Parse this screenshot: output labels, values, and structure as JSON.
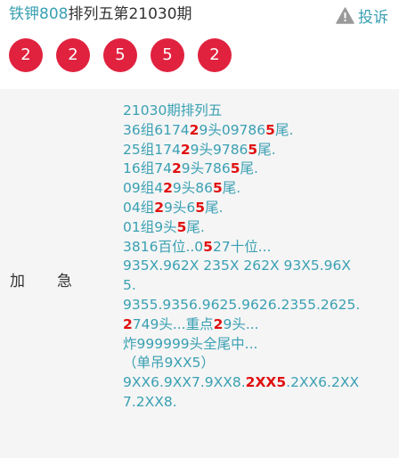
{
  "header": {
    "author": "铁钾808",
    "title_rest": "排列五第21030期",
    "report_label": "投诉",
    "report_icon": "warning-icon"
  },
  "balls": [
    "2",
    "2",
    "5",
    "5",
    "2"
  ],
  "side": {
    "label_1": "加",
    "label_2": "急"
  },
  "content": {
    "lines": [
      [
        {
          "t": "21030期排列五"
        }
      ],
      [
        {
          "t": "36组6174"
        },
        {
          "t": "2",
          "red": true
        },
        {
          "t": "9头09786"
        },
        {
          "t": "5",
          "red": true
        },
        {
          "t": "尾."
        }
      ],
      [
        {
          "t": "25组174"
        },
        {
          "t": "2",
          "red": true
        },
        {
          "t": "9头9786"
        },
        {
          "t": "5",
          "red": true
        },
        {
          "t": "尾."
        }
      ],
      [
        {
          "t": "16组74"
        },
        {
          "t": "2",
          "red": true
        },
        {
          "t": "9头786"
        },
        {
          "t": "5",
          "red": true
        },
        {
          "t": "尾."
        }
      ],
      [
        {
          "t": "09组4"
        },
        {
          "t": "2",
          "red": true
        },
        {
          "t": "9头86"
        },
        {
          "t": "5",
          "red": true
        },
        {
          "t": "尾."
        }
      ],
      [
        {
          "t": "04组"
        },
        {
          "t": "2",
          "red": true
        },
        {
          "t": "9头6"
        },
        {
          "t": "5",
          "red": true
        },
        {
          "t": "尾."
        }
      ],
      [
        {
          "t": "01组9头"
        },
        {
          "t": "5",
          "red": true
        },
        {
          "t": "尾."
        }
      ],
      [
        {
          "t": "3816百位..0"
        },
        {
          "t": "5",
          "red": true
        },
        {
          "t": "27十位..."
        }
      ],
      [
        {
          "t": "935X.962X 235X 262X 93X5.96X"
        }
      ],
      [
        {
          "t": "5."
        }
      ],
      [
        {
          "t": "9355.9356.9625.9626.2355.2625."
        }
      ],
      [
        {
          "t": "2",
          "red": true
        },
        {
          "t": "749头...重点"
        },
        {
          "t": "2",
          "red": true
        },
        {
          "t": "9头..."
        }
      ],
      [
        {
          "t": "炸999999头全尾中..."
        }
      ],
      [
        {
          "t": "（单吊9XX5）"
        }
      ],
      [
        {
          "t": "9XX6.9XX7.9XX8."
        },
        {
          "t": "2XX5",
          "red": true
        },
        {
          "t": ".2XX6.2XX"
        }
      ],
      [
        {
          "t": "7.2XX8."
        }
      ]
    ]
  },
  "colors": {
    "accent": "#3aa0b3",
    "ball": "#e0223f",
    "highlight": "#e01010",
    "panel_bg": "#f5f5f5"
  }
}
